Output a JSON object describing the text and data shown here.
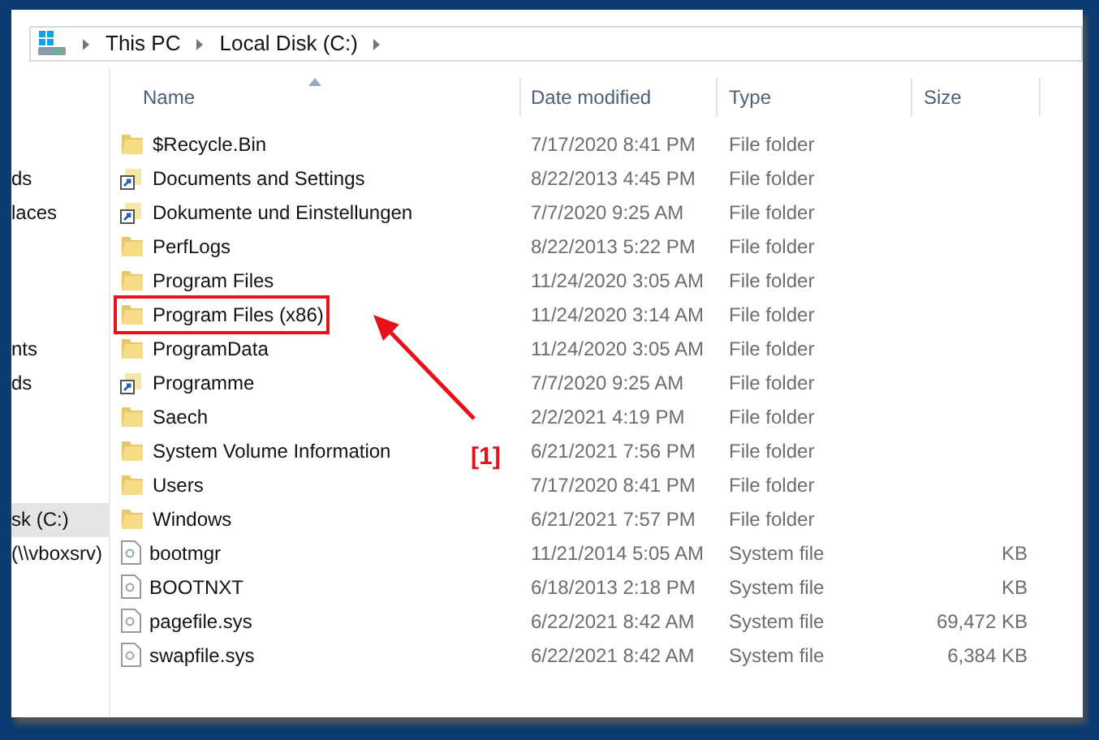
{
  "address_bar": {
    "crumbs": [
      "This PC",
      "Local Disk (C:)"
    ]
  },
  "sidebar": {
    "items": [
      {
        "label": "ds",
        "selected": false
      },
      {
        "label": "laces",
        "selected": false
      },
      {
        "label": "nts",
        "selected": false
      },
      {
        "label": "ds",
        "selected": false
      },
      {
        "label": "sk (C:)",
        "selected": true
      },
      {
        "label": "(\\\\vboxsrv)",
        "selected": false
      }
    ]
  },
  "table": {
    "columns": [
      "Name",
      "Date modified",
      "Type",
      "Size"
    ],
    "rows": [
      {
        "kind": "folder",
        "name": "$Recycle.Bin",
        "date": "7/17/2020 8:41 PM",
        "type": "File folder"
      },
      {
        "kind": "shortcut",
        "name": "Documents and Settings",
        "date": "8/22/2013 4:45 PM",
        "type": "File folder"
      },
      {
        "kind": "shortcut",
        "name": "Dokumente und Einstellungen",
        "date": "7/7/2020 9:25 AM",
        "type": "File folder"
      },
      {
        "kind": "folder",
        "name": "PerfLogs",
        "date": "8/22/2013 5:22 PM",
        "type": "File folder"
      },
      {
        "kind": "folder",
        "name": "Program Files",
        "date": "11/24/2020 3:05 AM",
        "type": "File folder"
      },
      {
        "kind": "folder",
        "name": "Program Files (x86)",
        "date": "11/24/2020 3:14 AM",
        "type": "File folder",
        "highlighted": true
      },
      {
        "kind": "folder",
        "name": "ProgramData",
        "date": "11/24/2020 3:05 AM",
        "type": "File folder"
      },
      {
        "kind": "shortcut",
        "name": "Programme",
        "date": "7/7/2020 9:25 AM",
        "type": "File folder"
      },
      {
        "kind": "folder",
        "name": "Saech",
        "date": "2/2/2021 4:19 PM",
        "type": "File folder"
      },
      {
        "kind": "folder",
        "name": "System Volume Information",
        "date": "6/21/2021 7:56 PM",
        "type": "File folder"
      },
      {
        "kind": "folder",
        "name": "Users",
        "date": "7/17/2020 8:41 PM",
        "type": "File folder"
      },
      {
        "kind": "folder",
        "name": "Windows",
        "date": "6/21/2021 7:57 PM",
        "type": "File folder"
      },
      {
        "kind": "file",
        "name": "bootmgr",
        "date": "11/21/2014 5:05 AM",
        "type": "System file",
        "size": "KB"
      },
      {
        "kind": "file",
        "name": "BOOTNXT",
        "date": "6/18/2013 2:18 PM",
        "type": "System file",
        "size": "KB"
      },
      {
        "kind": "file",
        "name": "pagefile.sys",
        "date": "6/22/2021 8:42 AM",
        "type": "System file",
        "size": "69,472 KB"
      },
      {
        "kind": "file",
        "name": "swapfile.sys",
        "date": "6/22/2021 8:42 AM",
        "type": "System file",
        "size": "6,384 KB"
      }
    ]
  },
  "annotation": {
    "label": "[1]"
  }
}
